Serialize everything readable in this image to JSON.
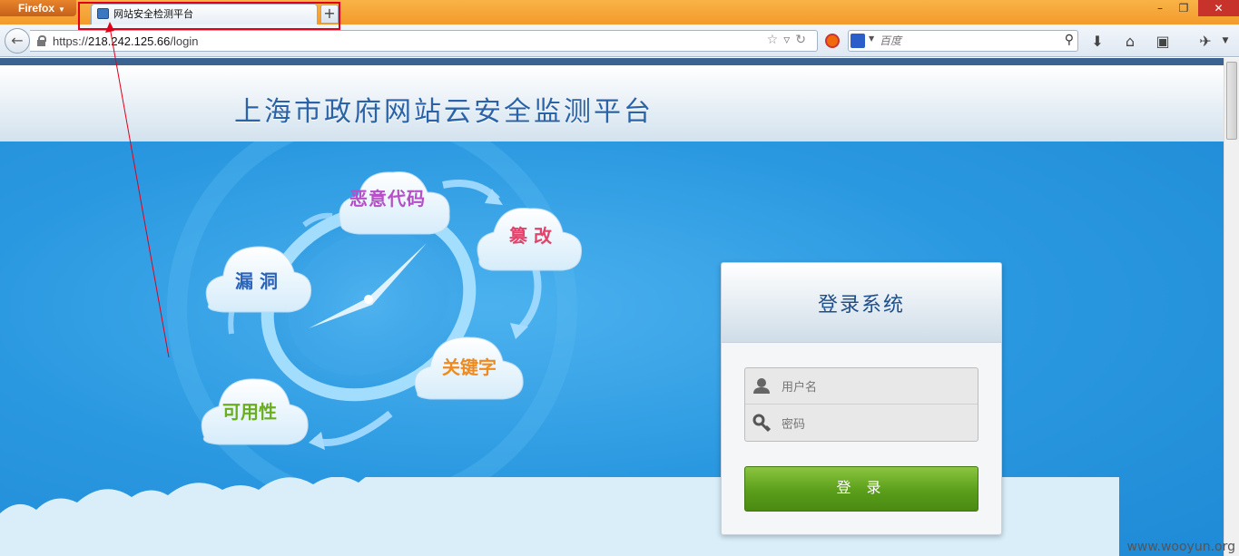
{
  "browser": {
    "menu_button": "Firefox",
    "tab_title": "网站安全检测平台",
    "new_tab": "+",
    "url_prefix": "https://",
    "url_host": "218.242.125.66",
    "url_path": "/login",
    "search_placeholder": "百度",
    "window_controls": {
      "minimize": "–",
      "maximize": "❐",
      "close": "✕"
    }
  },
  "page": {
    "site_title": "上海市政府网站云安全监测平台",
    "clouds": {
      "malicious_code": "恶意代码",
      "tamper": "篡 改",
      "vulnerability": "漏 洞",
      "keyword": "关键字",
      "availability": "可用性"
    },
    "login": {
      "title": "登录系统",
      "username_placeholder": "用户名",
      "password_placeholder": "密码",
      "submit_label": "登 录"
    }
  },
  "watermark": "www.wooyun.org",
  "colors": {
    "firefox_orange": "#f39a2c",
    "title_blue": "#2a63a8",
    "main_blue": "#2a98e0",
    "login_green": "#5a9e1a",
    "annotation_red": "#e3001b"
  }
}
